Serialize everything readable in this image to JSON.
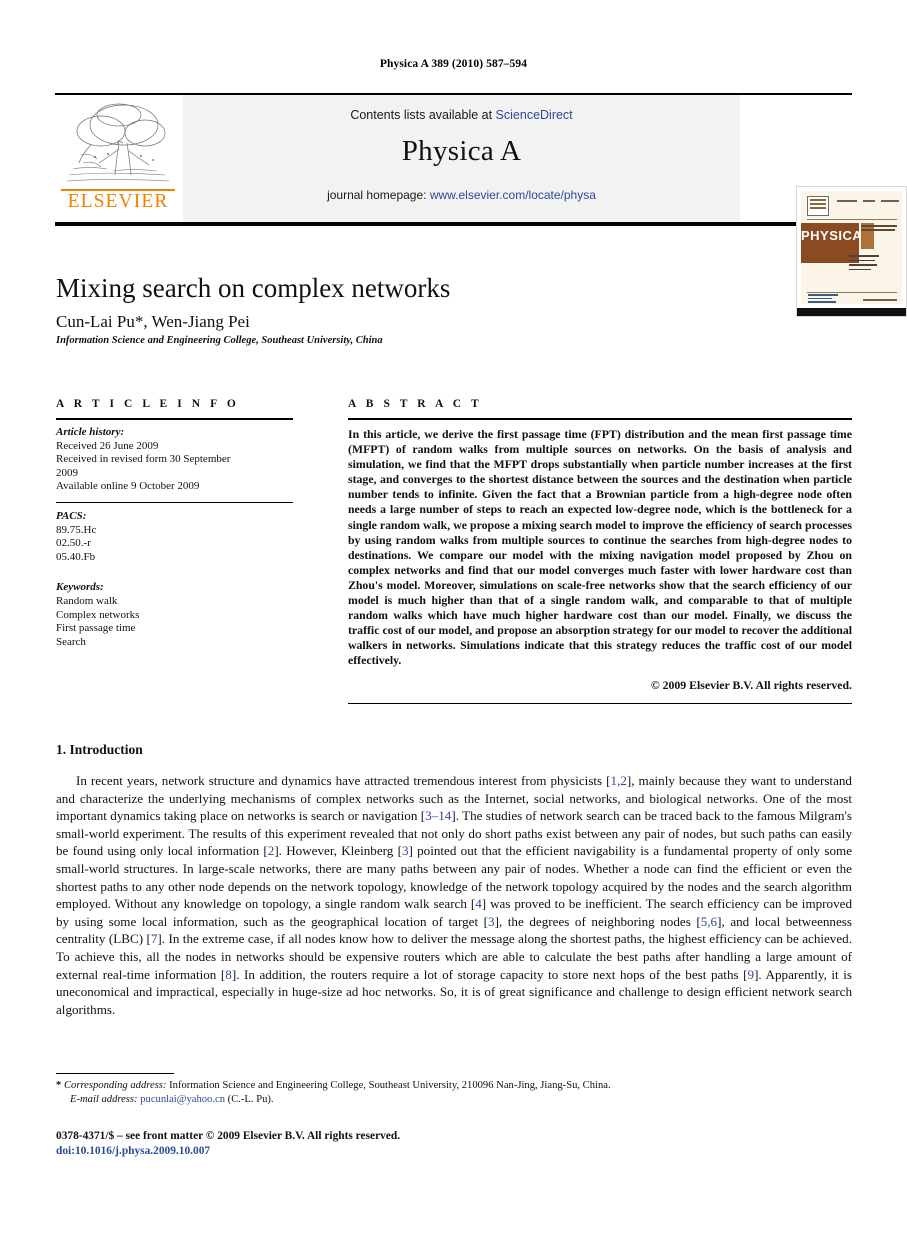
{
  "running_head": "Physica A 389 (2010) 587–594",
  "masthead": {
    "contents_prefix": "Contents lists available at ",
    "sciencedirect": "ScienceDirect",
    "journal_title": "Physica A",
    "homepage_prefix": "journal homepage: ",
    "homepage_url": "www.elsevier.com/locate/physa",
    "publisher_logo_text": "ELSEVIER",
    "cover_title": "PHYSICA",
    "cover_letter": "A",
    "link_color": "#2b4a9b",
    "logo_color": "#f08000"
  },
  "article": {
    "title": "Mixing search on complex networks",
    "authors": "Cun-Lai Pu*, Wen-Jiang Pei",
    "affiliation": "Information Science and Engineering College, Southeast University, China"
  },
  "info": {
    "heading": "A R T I C L E   I N F O",
    "history_label": "Article history:",
    "history_lines": [
      "Received 26 June 2009",
      "Received in revised form 30 September",
      "2009",
      "Available online 9 October 2009"
    ],
    "pacs_label": "PACS:",
    "pacs": [
      "89.75.Hc",
      "02.50.-r",
      "05.40.Fb"
    ],
    "keywords_label": "Keywords:",
    "keywords": [
      "Random walk",
      "Complex networks",
      "First passage time",
      "Search"
    ]
  },
  "abstract": {
    "heading": "A B S T R A C T",
    "text": "In this article, we derive the first passage time (FPT) distribution and the mean first passage time (MFPT) of random walks from multiple sources on networks. On the basis of analysis and simulation, we find that the MFPT drops substantially when particle number increases at the first stage, and converges to the shortest distance between the sources and the destination when particle number tends to infinite. Given the fact that a Brownian particle from a high-degree node often needs a large number of steps to reach an expected low-degree node, which is the bottleneck for a single random walk, we propose a mixing search model to improve the efficiency of search processes by using random walks from multiple sources to continue the searches from high-degree nodes to destinations. We compare our model with the mixing navigation model proposed by Zhou on complex networks and find that our model converges much faster with lower hardware cost than Zhou's model. Moreover, simulations on scale-free networks show that the search efficiency of our model is much higher than that of a single random walk, and comparable to that of multiple random walks which have much higher hardware cost than our model. Finally, we discuss the traffic cost of our model, and propose an absorption strategy for our model to recover the additional walkers in networks. Simulations indicate that this strategy reduces the traffic cost of our model effectively.",
    "copyright": "© 2009 Elsevier B.V. All rights reserved."
  },
  "section": {
    "number_title": "1. Introduction",
    "paragraph_parts": [
      "In recent years, network structure and dynamics have attracted tremendous interest from physicists [",
      "1,2",
      "], mainly because they want to understand and characterize the underlying mechanisms of complex networks such as the Internet, social networks, and biological networks. One of the most important dynamics taking place on networks is search or navigation [",
      "3–14",
      "]. The studies of network search can be traced back to the famous Milgram's small-world experiment. The results of this experiment revealed that not only do short paths exist between any pair of nodes, but such paths can easily be found using only local information [",
      "2",
      "]. However, Kleinberg [",
      "3",
      "] pointed out that the efficient navigability is a fundamental property of only some small-world structures. In large-scale networks, there are many paths between any pair of nodes. Whether a node can find the efficient or even the shortest paths to any other node depends on the network topology, knowledge of the network topology acquired by the nodes and the search algorithm employed. Without any knowledge on topology, a single random walk search [",
      "4",
      "] was proved to be inefficient. The search efficiency can be improved by using some local information, such as the geographical location of target [",
      "3",
      "], the degrees of neighboring nodes [",
      "5,6",
      "], and local betweenness centrality (LBC) [",
      "7",
      "]. In the extreme case, if all nodes know how to deliver the message along the shortest paths, the highest efficiency can be achieved. To achieve this, all the nodes in networks should be expensive routers which are able to calculate the best paths after handling a large amount of external real-time information [",
      "8",
      "]. In addition, the routers require a lot of storage capacity to store next hops of the best paths [",
      "9",
      "]. Apparently, it is uneconomical and impractical, especially in huge-size ad hoc networks. So, it is of great significance and challenge to design efficient network search algorithms."
    ]
  },
  "footnotes": {
    "star": "*",
    "corresponding_label": "Corresponding address:",
    "corresponding_text": " Information Science and Engineering College, Southeast University, 210096 Nan-Jing, Jiang-Su, China.",
    "email_label": "E-mail address:",
    "email": "pucunlai@yahoo.cn",
    "email_suffix": " (C.-L. Pu).",
    "imprint_line": "0378-4371/$ – see front matter © 2009 Elsevier B.V. All rights reserved.",
    "doi": "doi:10.1016/j.physa.2009.10.007"
  }
}
